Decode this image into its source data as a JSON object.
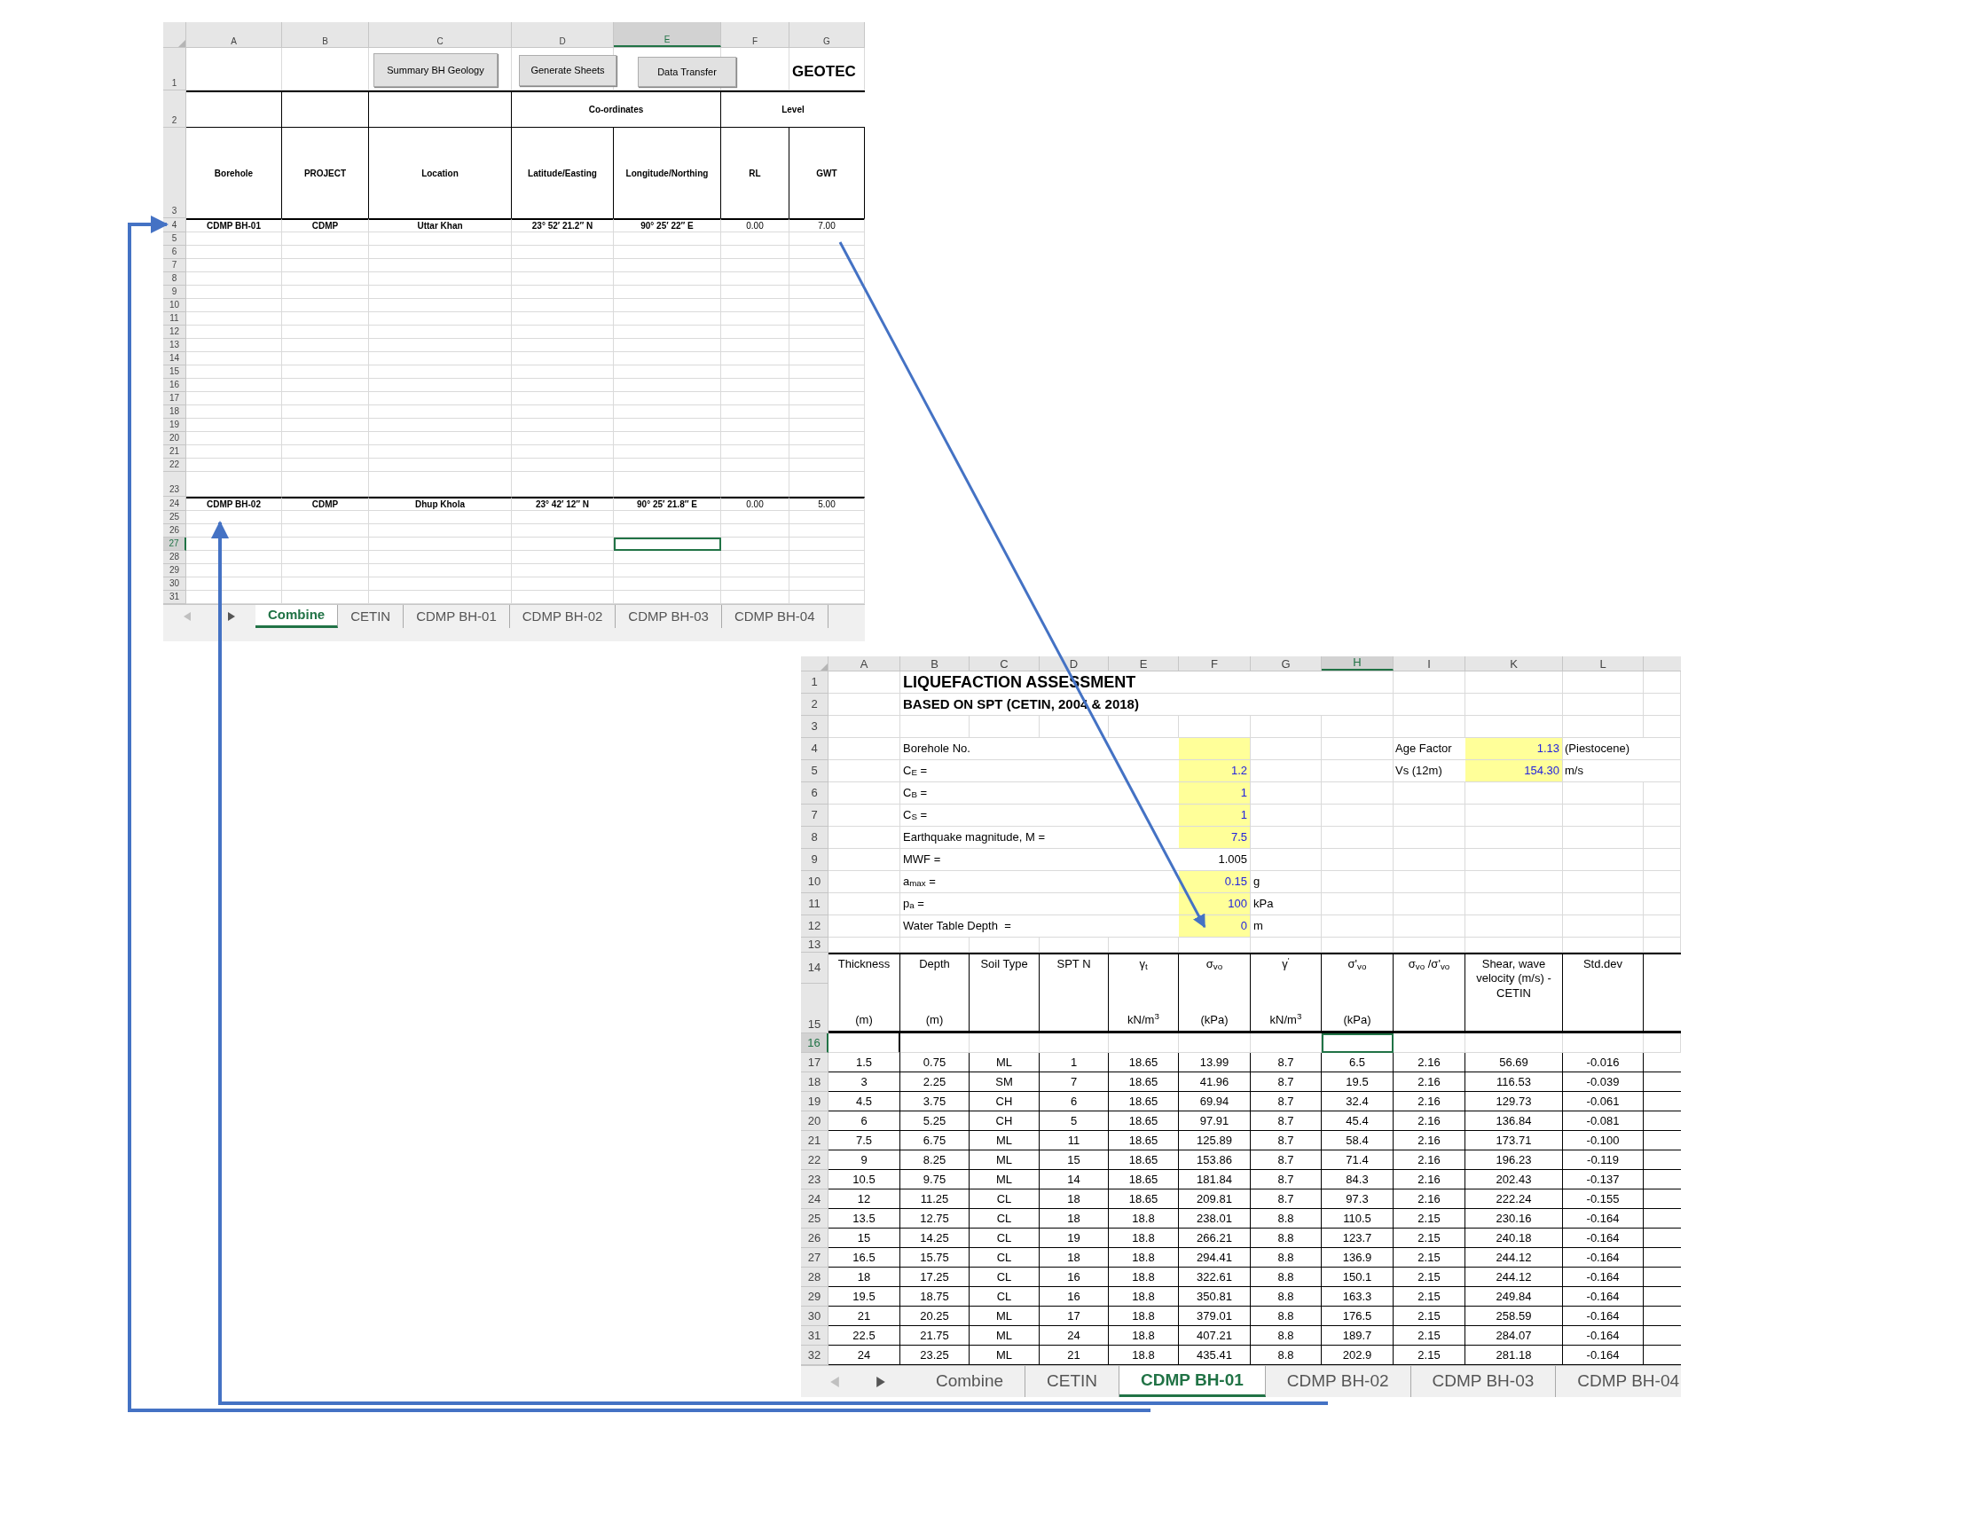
{
  "combine_sheet": {
    "columns": [
      {
        "label": "A",
        "selected": false
      },
      {
        "label": "B",
        "selected": false
      },
      {
        "label": "C",
        "selected": false
      },
      {
        "label": "D",
        "selected": false
      },
      {
        "label": "E",
        "selected": true
      },
      {
        "label": "F",
        "selected": false
      },
      {
        "label": "G",
        "selected": false
      }
    ],
    "buttons": [
      "Summary BH Geology",
      "Generate Sheets",
      "Data Transfer"
    ],
    "title": "GEOTEC",
    "group_headers": [
      "Co-ordinates",
      "Level"
    ],
    "headers": [
      "Borehole",
      "PROJECT",
      "Location",
      "Latitude/Easting",
      "Longitude/Northing",
      "RL",
      "GWT"
    ],
    "rows": [
      {
        "label": "1",
        "selected": false
      },
      {
        "label": "2",
        "selected": false
      },
      {
        "label": "3",
        "selected": false
      },
      {
        "label": "4",
        "selected": false,
        "cells": [
          "CDMP BH-01",
          "CDMP",
          "Uttar Khan",
          "23° 52′ 21.2″ N",
          "90° 25′ 22″ E",
          "0.00",
          "7.00"
        ]
      },
      {
        "label": "5",
        "selected": false
      },
      {
        "label": "6",
        "selected": false
      },
      {
        "label": "7",
        "selected": false
      },
      {
        "label": "8",
        "selected": false
      },
      {
        "label": "9",
        "selected": false
      },
      {
        "label": "10",
        "selected": false
      },
      {
        "label": "11",
        "selected": false
      },
      {
        "label": "12",
        "selected": false
      },
      {
        "label": "13",
        "selected": false
      },
      {
        "label": "14",
        "selected": false
      },
      {
        "label": "15",
        "selected": false
      },
      {
        "label": "16",
        "selected": false
      },
      {
        "label": "17",
        "selected": false
      },
      {
        "label": "18",
        "selected": false
      },
      {
        "label": "19",
        "selected": false
      },
      {
        "label": "20",
        "selected": false
      },
      {
        "label": "21",
        "selected": false
      },
      {
        "label": "22",
        "selected": false
      },
      {
        "label": "23",
        "selected": false
      },
      {
        "label": "24",
        "selected": false,
        "cells": [
          "CDMP BH-02",
          "CDMP",
          "Dhup Khola",
          "23° 42′ 12″ N",
          "90° 25′ 21.8″ E",
          "0.00",
          "5.00"
        ]
      },
      {
        "label": "25",
        "selected": false
      },
      {
        "label": "26",
        "selected": false
      },
      {
        "label": "27",
        "selected": true
      },
      {
        "label": "28",
        "selected": false
      },
      {
        "label": "29",
        "selected": false
      },
      {
        "label": "30",
        "selected": false
      },
      {
        "label": "31",
        "selected": false
      }
    ],
    "tabs": [
      {
        "label": "Combine",
        "selected": true
      },
      {
        "label": "CETIN",
        "selected": false
      },
      {
        "label": "CDMP BH-01",
        "selected": false
      },
      {
        "label": "CDMP BH-02",
        "selected": false
      },
      {
        "label": "CDMP BH-03",
        "selected": false
      },
      {
        "label": "CDMP BH-04",
        "selected": false
      }
    ]
  },
  "liquefaction_sheet": {
    "columns": [
      {
        "label": "A",
        "selected": false
      },
      {
        "label": "B",
        "selected": false
      },
      {
        "label": "C",
        "selected": false
      },
      {
        "label": "D",
        "selected": false
      },
      {
        "label": "E",
        "selected": false
      },
      {
        "label": "F",
        "selected": false
      },
      {
        "label": "G",
        "selected": false
      },
      {
        "label": "H",
        "selected": true
      },
      {
        "label": "I",
        "selected": false
      },
      {
        "label": "K",
        "selected": false
      },
      {
        "label": "L",
        "selected": false
      }
    ],
    "title": "LIQUEFACTION ASSESSMENT",
    "subtitle": "BASED ON SPT (CETIN, 2004 & 2018)",
    "parameters": [
      {
        "label": "Borehole No.",
        "input": true
      },
      {
        "label": "C$_{E}$ =",
        "value": "1.2",
        "input": true
      },
      {
        "label": "C$_{B}$ =",
        "value": "1",
        "input": true
      },
      {
        "label": "C$_{S}$ =",
        "value": "1",
        "input": true
      },
      {
        "label": "Earthquake magnitude, M =",
        "value": "7.5",
        "input": true
      },
      {
        "label": "MWF =",
        "value": "1.005",
        "input": false
      },
      {
        "label": "a$_{max}$ =",
        "value": "0.15",
        "unit": "g",
        "input": true
      },
      {
        "label": "p$_{a}$ =",
        "value": "100",
        "unit": "kPa",
        "input": true
      },
      {
        "label": "Water Table Depth  =",
        "value": "0",
        "unit": "m",
        "input": true
      }
    ],
    "side_parameters": [
      {
        "label": "Age Factor",
        "value": "1.13",
        "unit": "(Piestocene)",
        "input": true
      },
      {
        "label": "Vs (12m)",
        "value": "154.30",
        "unit": "m/s",
        "input": true
      }
    ],
    "table_headers": [
      {
        "top": "Thickness",
        "bottom": "(m)"
      },
      {
        "top": "Depth",
        "bottom": "(m)"
      },
      {
        "top": "Soil Type"
      },
      {
        "top": "SPT N"
      },
      {
        "top": "γ$_{t}$",
        "bottom": "kN/m$^{3}$"
      },
      {
        "top": "σ$_{vo}$",
        "bottom": "(kPa)"
      },
      {
        "top": "γ$^{'}$",
        "bottom": "kN/m$^{3}$"
      },
      {
        "top": "σ'$_{vo}$",
        "bottom": "(kPa)"
      },
      {
        "top": "σ$_{vo}$ /σ'$_{vo}$"
      },
      {
        "top": "Shear, wave velocity (m/s) - CETIN"
      },
      {
        "top": "Std.dev"
      }
    ],
    "rows": [
      {
        "label": "1",
        "selected": false
      },
      {
        "label": "2",
        "selected": false
      },
      {
        "label": "3",
        "selected": false
      },
      {
        "label": "4",
        "selected": false
      },
      {
        "label": "5",
        "selected": false
      },
      {
        "label": "6",
        "selected": false
      },
      {
        "label": "7",
        "selected": false
      },
      {
        "label": "8",
        "selected": false
      },
      {
        "label": "9",
        "selected": false
      },
      {
        "label": "10",
        "selected": false
      },
      {
        "label": "11",
        "selected": false
      },
      {
        "label": "12",
        "selected": false
      },
      {
        "label": "13",
        "selected": false
      },
      {
        "label": "14",
        "selected": false
      },
      {
        "label": "15",
        "selected": false
      },
      {
        "label": "16",
        "selected": true
      },
      {
        "label": "17",
        "selected": false,
        "cells": [
          "1.5",
          "0.75",
          "ML",
          "1",
          "18.65",
          "13.99",
          "8.7",
          "6.5",
          "2.16",
          "56.69",
          "-0.016"
        ]
      },
      {
        "label": "18",
        "selected": false,
        "cells": [
          "3",
          "2.25",
          "SM",
          "7",
          "18.65",
          "41.96",
          "8.7",
          "19.5",
          "2.16",
          "116.53",
          "-0.039"
        ]
      },
      {
        "label": "19",
        "selected": false,
        "cells": [
          "4.5",
          "3.75",
          "CH",
          "6",
          "18.65",
          "69.94",
          "8.7",
          "32.4",
          "2.16",
          "129.73",
          "-0.061"
        ]
      },
      {
        "label": "20",
        "selected": false,
        "cells": [
          "6",
          "5.25",
          "CH",
          "5",
          "18.65",
          "97.91",
          "8.7",
          "45.4",
          "2.16",
          "136.84",
          "-0.081"
        ]
      },
      {
        "label": "21",
        "selected": false,
        "cells": [
          "7.5",
          "6.75",
          "ML",
          "11",
          "18.65",
          "125.89",
          "8.7",
          "58.4",
          "2.16",
          "173.71",
          "-0.100"
        ]
      },
      {
        "label": "22",
        "selected": false,
        "cells": [
          "9",
          "8.25",
          "ML",
          "15",
          "18.65",
          "153.86",
          "8.7",
          "71.4",
          "2.16",
          "196.23",
          "-0.119"
        ]
      },
      {
        "label": "23",
        "selected": false,
        "cells": [
          "10.5",
          "9.75",
          "ML",
          "14",
          "18.65",
          "181.84",
          "8.7",
          "84.3",
          "2.16",
          "202.43",
          "-0.137"
        ]
      },
      {
        "label": "24",
        "selected": false,
        "cells": [
          "12",
          "11.25",
          "CL",
          "18",
          "18.65",
          "209.81",
          "8.7",
          "97.3",
          "2.16",
          "222.24",
          "-0.155"
        ]
      },
      {
        "label": "25",
        "selected": false,
        "cells": [
          "13.5",
          "12.75",
          "CL",
          "18",
          "18.8",
          "238.01",
          "8.8",
          "110.5",
          "2.15",
          "230.16",
          "-0.164"
        ]
      },
      {
        "label": "26",
        "selected": false,
        "cells": [
          "15",
          "14.25",
          "CL",
          "19",
          "18.8",
          "266.21",
          "8.8",
          "123.7",
          "2.15",
          "240.18",
          "-0.164"
        ]
      },
      {
        "label": "27",
        "selected": false,
        "cells": [
          "16.5",
          "15.75",
          "CL",
          "18",
          "18.8",
          "294.41",
          "8.8",
          "136.9",
          "2.15",
          "244.12",
          "-0.164"
        ]
      },
      {
        "label": "28",
        "selected": false,
        "cells": [
          "18",
          "17.25",
          "CL",
          "16",
          "18.8",
          "322.61",
          "8.8",
          "150.1",
          "2.15",
          "244.12",
          "-0.164"
        ]
      },
      {
        "label": "29",
        "selected": false,
        "cells": [
          "19.5",
          "18.75",
          "CL",
          "16",
          "18.8",
          "350.81",
          "8.8",
          "163.3",
          "2.15",
          "249.84",
          "-0.164"
        ]
      },
      {
        "label": "30",
        "selected": false,
        "cells": [
          "21",
          "20.25",
          "ML",
          "17",
          "18.8",
          "379.01",
          "8.8",
          "176.5",
          "2.15",
          "258.59",
          "-0.164"
        ]
      },
      {
        "label": "31",
        "selected": false,
        "cells": [
          "22.5",
          "21.75",
          "ML",
          "24",
          "18.8",
          "407.21",
          "8.8",
          "189.7",
          "2.15",
          "284.07",
          "-0.164"
        ]
      },
      {
        "label": "32",
        "selected": false,
        "cells": [
          "24",
          "23.25",
          "ML",
          "21",
          "18.8",
          "435.41",
          "8.8",
          "202.9",
          "2.15",
          "281.18",
          "-0.164"
        ]
      }
    ],
    "tabs": [
      {
        "label": "Combine",
        "selected": false
      },
      {
        "label": "CETIN",
        "selected": false
      },
      {
        "label": "CDMP BH-01",
        "selected": true
      },
      {
        "label": "CDMP BH-02",
        "selected": false
      },
      {
        "label": "CDMP BH-03",
        "selected": false
      },
      {
        "label": "CDMP BH-04",
        "selected": false
      }
    ]
  }
}
